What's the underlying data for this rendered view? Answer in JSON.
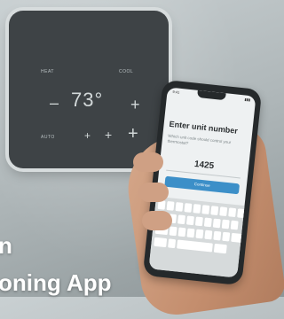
{
  "thermostat": {
    "label_left": "HEAT",
    "label_right": "COOL",
    "label_auto": "AUTO",
    "temperature": "73°",
    "minus_symbol": "–",
    "plus_symbol": "+"
  },
  "phone": {
    "status_time": "9:41",
    "status_battery": "▮▮▮",
    "title": "Enter unit number",
    "subtitle": "Which unit code should control your thermostat?",
    "unit_code": "1425",
    "button_label": "Continue"
  },
  "headline": {
    "line1": "n",
    "line2": "oning App"
  },
  "colors": {
    "thermostat_body": "#3e4346",
    "phone_accent": "#3c8fc8",
    "headline_text": "#ffffff"
  }
}
